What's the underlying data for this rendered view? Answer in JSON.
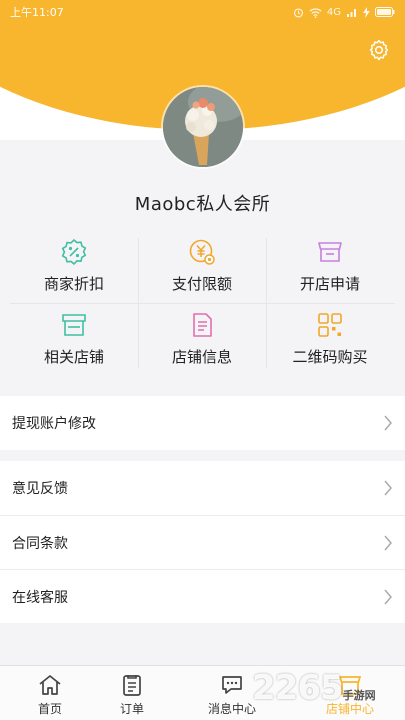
{
  "status_bar": {
    "time": "上午11:07",
    "network": "4G",
    "icons": [
      "alarm-icon",
      "wifi-icon",
      "signal-icon",
      "charging-icon"
    ]
  },
  "header": {
    "settings_icon": "gear-icon",
    "accent_color": "#f8b52e"
  },
  "profile": {
    "shop_name": "Maobc私人会所"
  },
  "grid": [
    {
      "label": "商家折扣",
      "icon": "discount-icon",
      "color": "#3fbfa4"
    },
    {
      "label": "支付限额",
      "icon": "payment-limit-icon",
      "color": "#f2a62a"
    },
    {
      "label": "开店申请",
      "icon": "open-store-icon",
      "color": "#c77ee0"
    },
    {
      "label": "相关店铺",
      "icon": "store-icon",
      "color": "#3fbfa4"
    },
    {
      "label": "店铺信息",
      "icon": "document-icon",
      "color": "#e26fb0"
    },
    {
      "label": "二维码购买",
      "icon": "qr-code-icon",
      "color": "#f2a62a"
    }
  ],
  "menu_primary": [
    {
      "label": "提现账户修改"
    }
  ],
  "menu_secondary": [
    {
      "label": "意见反馈"
    },
    {
      "label": "合同条款"
    },
    {
      "label": "在线客服"
    }
  ],
  "tabs": [
    {
      "label": "首页",
      "icon": "home-icon",
      "active": false
    },
    {
      "label": "订单",
      "icon": "order-icon",
      "active": false
    },
    {
      "label": "消息中心",
      "icon": "message-icon",
      "active": false
    },
    {
      "label": "店铺中心",
      "icon": "store-center-icon",
      "active": true
    }
  ],
  "watermark": {
    "text": "2265",
    "suffix": "手游网"
  }
}
